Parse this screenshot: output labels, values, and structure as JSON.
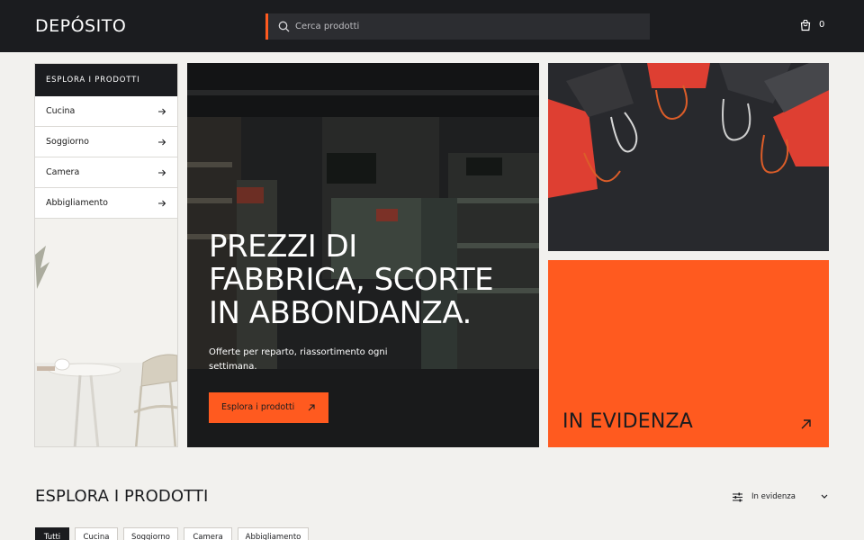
{
  "header": {
    "logo": "DEPÓSITO",
    "search_placeholder": "Cerca prodotti",
    "cart_count": "0"
  },
  "sidebar": {
    "title": "ESPLORA I PRODOTTI",
    "items": [
      {
        "label": "Cucina"
      },
      {
        "label": "Soggiorno"
      },
      {
        "label": "Camera"
      },
      {
        "label": "Abbigliamento"
      }
    ]
  },
  "hero": {
    "headline": [
      "PREZZI DI",
      "FABBRICA, SCORTE",
      "IN ABBONDANZA."
    ],
    "subtitle": "Offerte per reparto, riassortimento ogni settimana.",
    "button": "Esplora i prodotti"
  },
  "featured": {
    "label": "IN EVIDENZA"
  },
  "products": {
    "title": "ESPLORA I PRODOTTI",
    "sort_selected": "In evidenza",
    "tabs": [
      "Tutti",
      "Cucina",
      "Soggiorno",
      "Camera",
      "Abbigliamento"
    ],
    "active_tab": "Tutti"
  },
  "colors": {
    "accent": "#ff5a1f",
    "dark": "#1b1c1f",
    "background": "#f2f1ee"
  },
  "icons": {
    "search": "search-icon",
    "cart": "shopping-bag-icon",
    "arrow": "arrow-right-icon",
    "external": "arrow-up-right-icon",
    "filter": "sliders-icon",
    "chevron": "chevron-down-icon"
  }
}
